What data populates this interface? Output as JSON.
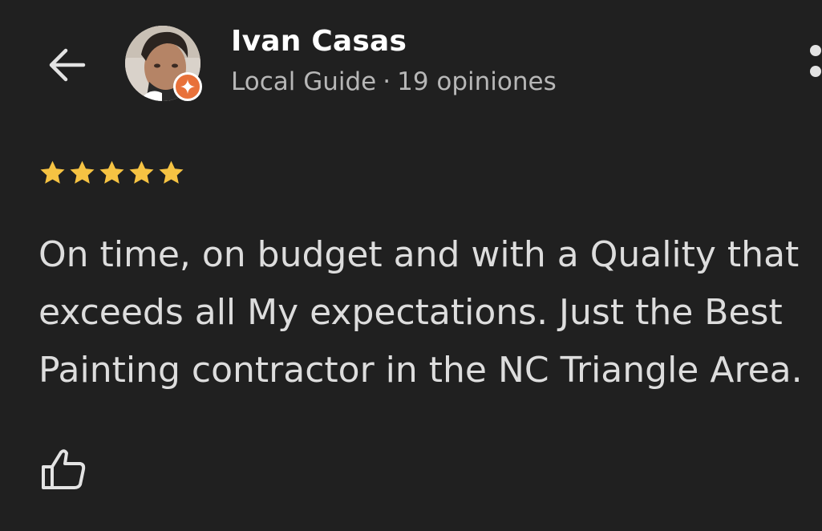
{
  "header": {
    "back_icon": "arrow-left-icon",
    "more_icon": "more-vertical-icon"
  },
  "reviewer": {
    "name": "Ivan Casas",
    "level": "Local Guide",
    "separator": "·",
    "review_count": "19 opiniones",
    "badge_icon": "local-guide-star-icon",
    "badge_color": "#e8713a"
  },
  "review": {
    "rating": 5,
    "rating_max": 5,
    "star_color": "#f6c343",
    "text": "On time, on budget and with a Quality that\nexceeds all My expectations. Just the Best\nPainting contractor in the NC Triangle Area."
  },
  "actions": {
    "like_icon": "thumbs-up-icon"
  },
  "colors": {
    "background": "#202020",
    "primary_text": "#ffffff",
    "secondary_text": "#b7b7b7",
    "body_text": "#dddddd"
  }
}
